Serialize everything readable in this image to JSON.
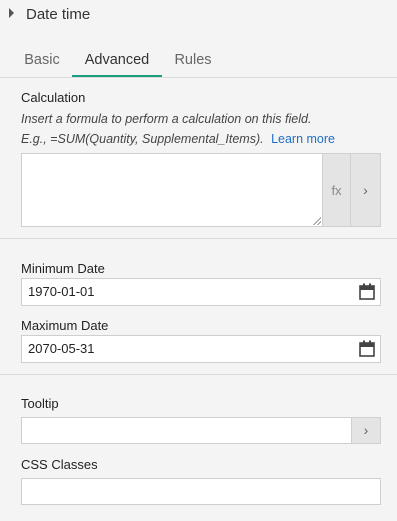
{
  "header": {
    "title": "Date time",
    "caret_icon": "caret-right-icon"
  },
  "tabs": [
    {
      "label": "Basic",
      "active": false
    },
    {
      "label": "Advanced",
      "active": true
    },
    {
      "label": "Rules",
      "active": false
    }
  ],
  "calculation": {
    "label": "Calculation",
    "hint_line1": "Insert a formula to perform a calculation on this field.",
    "hint_line2": "E.g., =SUM(Quantity, Supplemental_Items).",
    "learn_more": "Learn more",
    "value": "",
    "fx_label": "fx",
    "arrow": "›"
  },
  "min_date": {
    "label": "Minimum Date",
    "value": "1970-01-01",
    "icon": "calendar-icon"
  },
  "max_date": {
    "label": "Maximum Date",
    "value": "2070-05-31",
    "icon": "calendar-icon"
  },
  "tooltip": {
    "label": "Tooltip",
    "value": "",
    "arrow": "›"
  },
  "css_classes": {
    "label": "CSS Classes",
    "value": ""
  },
  "colors": {
    "accent": "#1a9e7e",
    "link": "#1f6fc5",
    "background": "#f4f4f4"
  }
}
